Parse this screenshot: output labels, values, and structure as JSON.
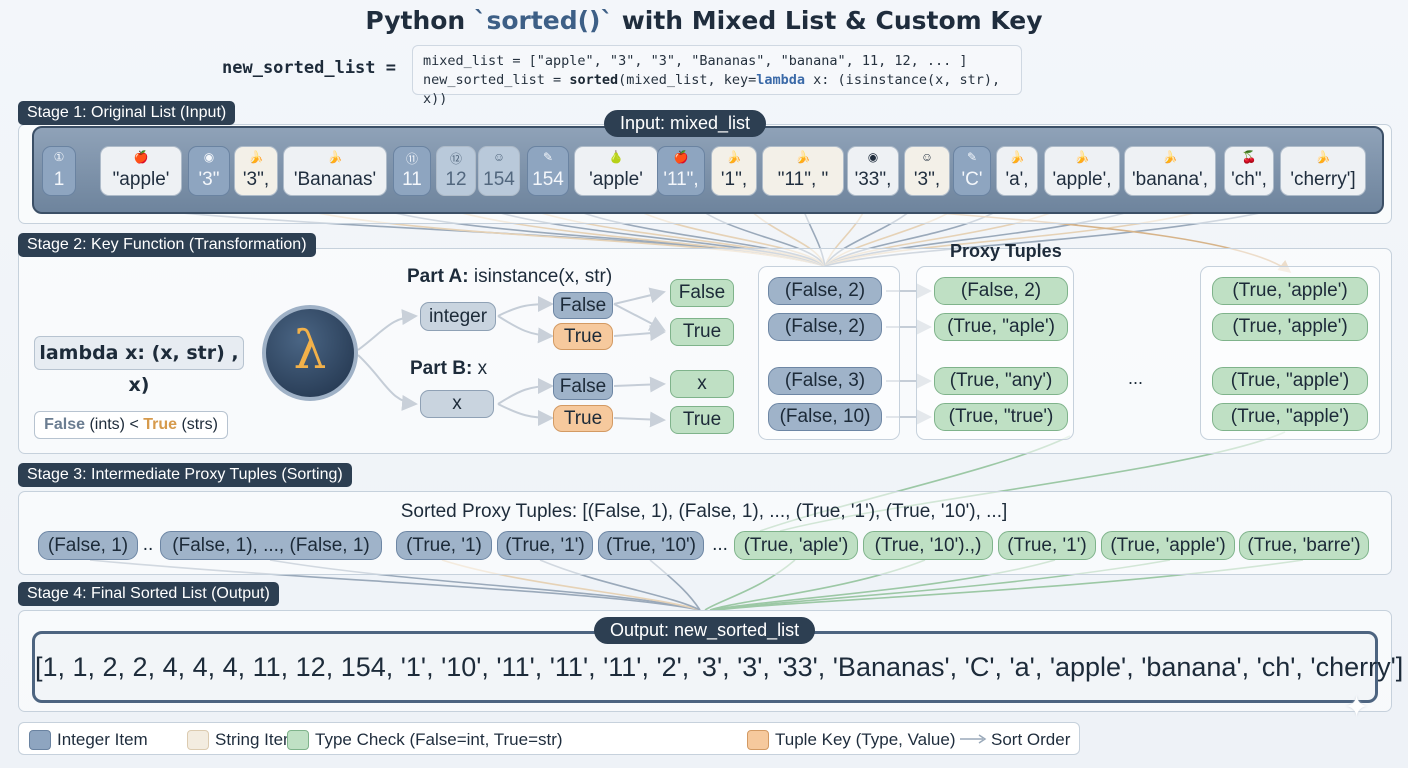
{
  "title": {
    "prefix": "Python ",
    "keyword": "`sorted()`",
    "suffix": " with Mixed List & Custom Key"
  },
  "code": {
    "lhs": "new_sorted_list =",
    "line1": "mixed_list = [\"apple\", \"3\", \"3\", \"Bananas\", \"banana\", 11, 12, ... ]",
    "line2_a": "new_sorted_list = ",
    "line2_b": "sorted",
    "line2_c": "(mixed_list, key=",
    "line2_d": "lambda",
    "line2_e": " x: (isinstance(x, str), x))"
  },
  "stage1": {
    "label": "Stage 1: Original List (Input)",
    "pill": "Input: mixed_list",
    "items": [
      {
        "text": "1",
        "icon": "①",
        "kind": "int"
      },
      {
        "text": "\"apple'",
        "icon": "🍎",
        "kind": "str"
      },
      {
        "text": "'3\"",
        "icon": "◉",
        "kind": "int"
      },
      {
        "text": "'3\",",
        "icon": "🍌",
        "kind": "str2"
      },
      {
        "text": "'Bananas'",
        "icon": "🍌",
        "kind": "str"
      },
      {
        "text": "11",
        "icon": "⑪",
        "kind": "int"
      },
      {
        "text": "12",
        "icon": "⑫",
        "kind": "int2"
      },
      {
        "text": "154",
        "icon": "☺",
        "kind": "int2"
      },
      {
        "text": "154",
        "icon": "✎",
        "kind": "int"
      },
      {
        "text": "'apple'",
        "icon": "🍐",
        "kind": "str"
      },
      {
        "text": "'11\",",
        "icon": "🍎",
        "kind": "int"
      },
      {
        "text": "'1\",",
        "icon": "🍌",
        "kind": "str2"
      },
      {
        "text": "\"11\", \"",
        "icon": "🍌",
        "kind": "str2"
      },
      {
        "text": "'33\",",
        "icon": "◉",
        "kind": "str"
      },
      {
        "text": "'3\",",
        "icon": "☺",
        "kind": "str2"
      },
      {
        "text": "'C'",
        "icon": "✎",
        "kind": "int"
      },
      {
        "text": "'a',",
        "icon": "🍌",
        "kind": "str"
      },
      {
        "text": "'apple',",
        "icon": "🍌",
        "kind": "str"
      },
      {
        "text": "'banana',",
        "icon": "🍌",
        "kind": "str"
      },
      {
        "text": "'ch\",",
        "icon": "🍒",
        "kind": "str"
      },
      {
        "text": "'cherry']",
        "icon": "🍌",
        "kind": "str"
      }
    ]
  },
  "stage2": {
    "label": "Stage 2: Key Function (Transformation)",
    "lambda_label": "lambda x: (x, str) , x)",
    "lambda_symbol": "λ",
    "cmp_false": "False",
    "cmp_mid": " (ints) < ",
    "cmp_true": "True",
    "cmp_end": " (strs)",
    "partA_title": "Part A:",
    "partA_expr": " isinstance(x, str)",
    "partB_title": "Part B:",
    "partB_expr": " x",
    "integer": "integer",
    "x": "x",
    "a_false": "False",
    "a_true": "True",
    "a_out_false": "False",
    "a_out_true": "True",
    "b_false": "False",
    "b_true": "True",
    "b_out_x": "x",
    "b_out_true": "True",
    "proxy_title": "Proxy Tuples",
    "ellipsis": "...",
    "col1": [
      "(False, 2)",
      "(False, 2)",
      "(False, 3)",
      "(False, 10)"
    ],
    "col2": [
      "(False, 2)",
      "(True, \"aple')",
      "(True, \"any')",
      "(True, \"true')"
    ],
    "col3": [
      "(True,  'apple')",
      "(True, 'apple')",
      "(True, \"apple')",
      "(True, \"apple')"
    ]
  },
  "stage3": {
    "label": "Stage 3: Intermediate Proxy Tuples (Sorting)",
    "heading": "Sorted Proxy Tuples: [(False, 1), (False, 1), ..., (True, '1'), (True, '10'), ...]",
    "tuples": [
      {
        "text": "(False, 1)",
        "kind": "blue"
      },
      {
        "text": "..",
        "kind": "sep"
      },
      {
        "text": "(False, 1), ..., (False, 1)",
        "kind": "blue"
      },
      {
        "text": "(True, '1)",
        "kind": "blue"
      },
      {
        "text": "(True, '1')",
        "kind": "blue"
      },
      {
        "text": "(True, '10')",
        "kind": "blue"
      },
      {
        "text": "...",
        "kind": "sep"
      },
      {
        "text": "(True, 'aple')",
        "kind": "green"
      },
      {
        "text": "(True, '10').,)",
        "kind": "green"
      },
      {
        "text": "(True, '1')",
        "kind": "green"
      },
      {
        "text": "(True, 'apple')",
        "kind": "green"
      },
      {
        "text": "(True, 'barre')",
        "kind": "green"
      }
    ]
  },
  "stage4": {
    "label": "Stage 4: Final Sorted List (Output)",
    "pill": "Output: new_sorted_list",
    "result": "[1, 1, 2, 2, 4, 4, 4, 11, 12, 154, '1', '10', '11', '11', '11', '2', '3', '3', '33', 'Bananas', 'C', 'a', 'apple', 'banana', 'ch', 'cherry']"
  },
  "legend": {
    "integer": "Integer Item",
    "string": "String Item",
    "typecheck": "Type Check (False=int, True=str)",
    "tuplekey": "Tuple Key (Type, Value)",
    "sortorder": "Sort Order"
  },
  "colors": {
    "int": "#8ea5c0",
    "str": "#f3ece0",
    "green": "#bfe0c4",
    "orange": "#f6c99d",
    "dark": "#2d3f52"
  }
}
